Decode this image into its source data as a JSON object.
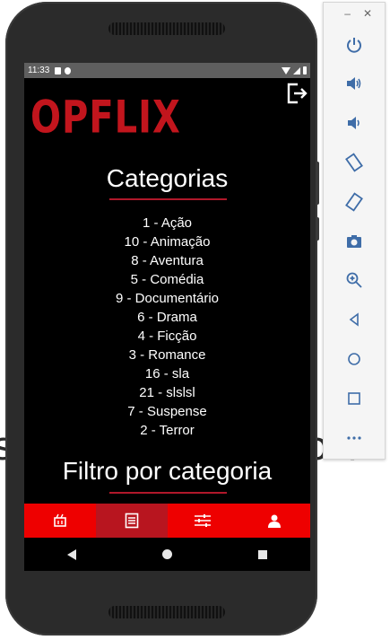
{
  "background": {
    "left_text": "s",
    "right_text": "orl"
  },
  "status_bar": {
    "time": "11:33"
  },
  "app": {
    "logo": "OPFLIX",
    "categories_title": "Categorias",
    "categories": [
      "1 - Ação",
      "10 - Animação",
      "8 - Aventura",
      "5 - Comédia",
      "9 - Documentário",
      "6 - Drama",
      "4 - Ficção",
      "3 - Romance",
      "16 - sla",
      "21 - slslsl",
      "7 - Suspense",
      "2 - Terror"
    ],
    "filter_title": "Filtro por categoria"
  },
  "bottom_nav": [
    {
      "icon": "ticket-icon",
      "active": false
    },
    {
      "icon": "list-icon",
      "active": true
    },
    {
      "icon": "sliders-icon",
      "active": false
    },
    {
      "icon": "user-icon",
      "active": false
    }
  ],
  "emulator": {
    "window_controls": {
      "minimize": "–",
      "close": "✕"
    },
    "buttons": [
      "power-icon",
      "volume-up-icon",
      "volume-down-icon",
      "rotate-left-icon",
      "rotate-right-icon",
      "camera-icon",
      "zoom-icon",
      "back-icon",
      "home-icon",
      "overview-icon",
      "more-icon"
    ]
  },
  "colors": {
    "brand_red": "#c2151d",
    "nav_red": "#ee0000",
    "nav_active": "#b8151f"
  }
}
